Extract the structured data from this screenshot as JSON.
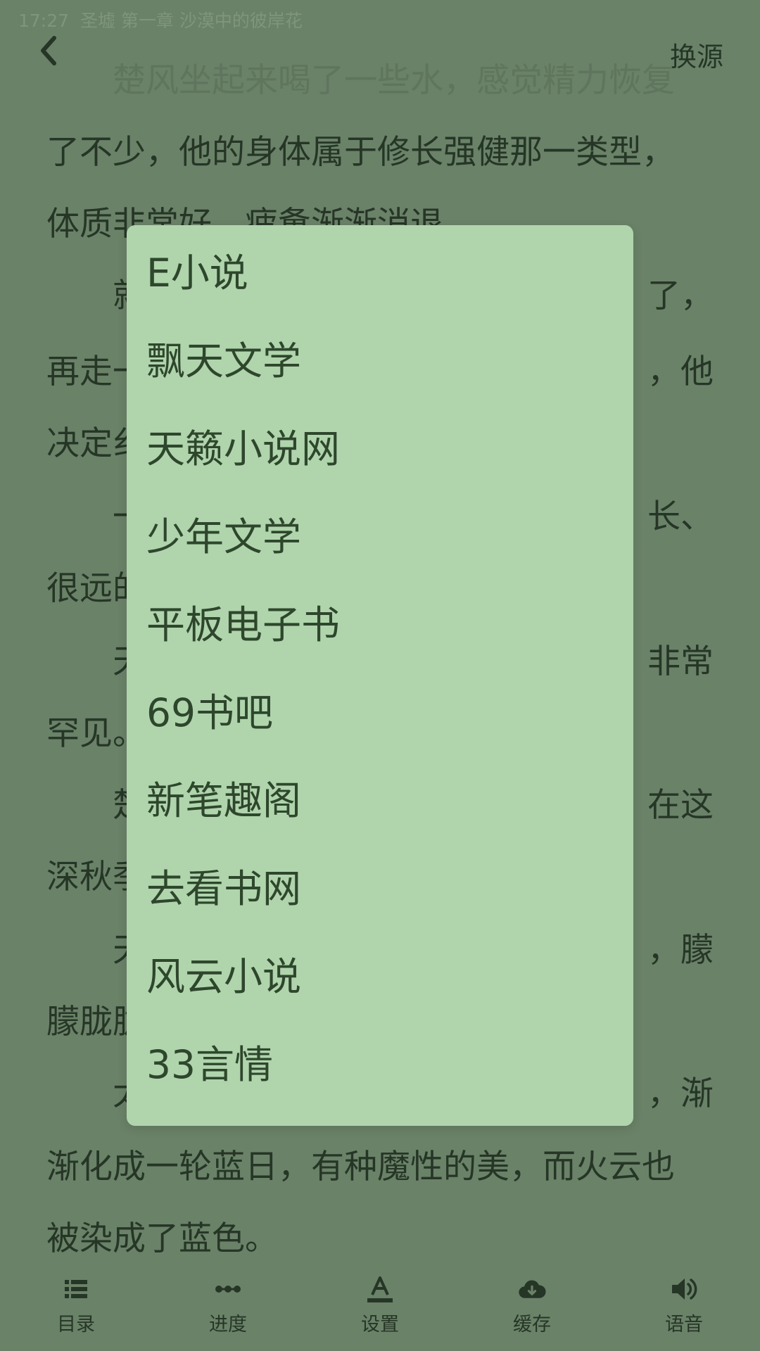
{
  "status": {
    "time": "17:27",
    "chapter": "圣墟 第一章 沙漠中的彼岸花"
  },
  "header": {
    "source_label": "换源",
    "back_icon": "chevron-left-icon"
  },
  "content": {
    "lines": [
      "　　楚风坐起来喝了一些水，感觉精力恢复",
      "了不少，他的身体属于修长强健那一类型，",
      "体质非常好，疲惫渐渐消退。",
      "　　就",
      "再走一",
      "决定纟",
      "　　一",
      "很远的",
      "　　天",
      "罕见。",
      "　　楚",
      "深秋季",
      "　　天",
      "朦胧胧",
      "　　太",
      "渐化成一轮蓝日，有种魔性的美，而火云也",
      "被染成了蓝色。"
    ],
    "right_fragments": [
      "了，",
      "，他",
      "长、",
      "非常",
      "在这",
      "，朦",
      "，渐"
    ]
  },
  "source_dialog": {
    "items": [
      "E小说",
      "飘天文学",
      "天籁小说网",
      "少年文学",
      "平板电子书",
      "69书吧",
      "新笔趣阁",
      "去看书网",
      "风云小说",
      "33言情"
    ]
  },
  "toolbar": {
    "items": [
      {
        "label": "目录",
        "icon": "list-icon"
      },
      {
        "label": "进度",
        "icon": "progress-icon"
      },
      {
        "label": "设置",
        "icon": "font-settings-icon"
      },
      {
        "label": "缓存",
        "icon": "cloud-download-icon"
      },
      {
        "label": "语音",
        "icon": "speaker-icon"
      }
    ]
  },
  "colors": {
    "background": "#6a8268",
    "dialog": "#b0d5ad",
    "text": "#263626"
  }
}
